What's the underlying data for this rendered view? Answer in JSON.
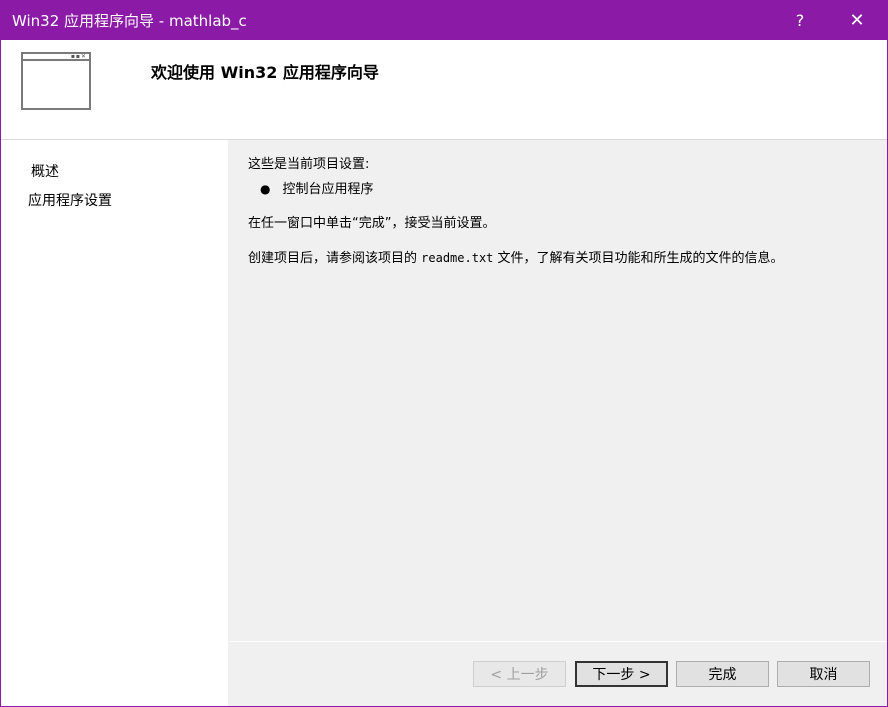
{
  "window": {
    "title": "Win32 应用程序向导 - mathlab_c",
    "help_glyph": "?",
    "close_glyph": "✕",
    "accent_color": "#8b1aa6"
  },
  "header": {
    "title": "欢迎使用 Win32 应用程序向导",
    "icon": "window-icon"
  },
  "nav": {
    "items": [
      {
        "label": "概述"
      },
      {
        "label": "应用程序设置"
      }
    ]
  },
  "content": {
    "current_settings": "这些是当前项目设置:",
    "bullet": "控制台应用程序",
    "finish_hint": "在任一窗口中单击“完成”，接受当前设置。",
    "readme_pre": "创建项目后，请参阅该项目的 ",
    "readme_file": "readme.txt",
    "readme_post": " 文件，了解有关项目功能和所生成的文件的信息。"
  },
  "buttons": {
    "prev": "< 上一步",
    "next": "下一步 >",
    "finish": "完成",
    "cancel": "取消"
  }
}
